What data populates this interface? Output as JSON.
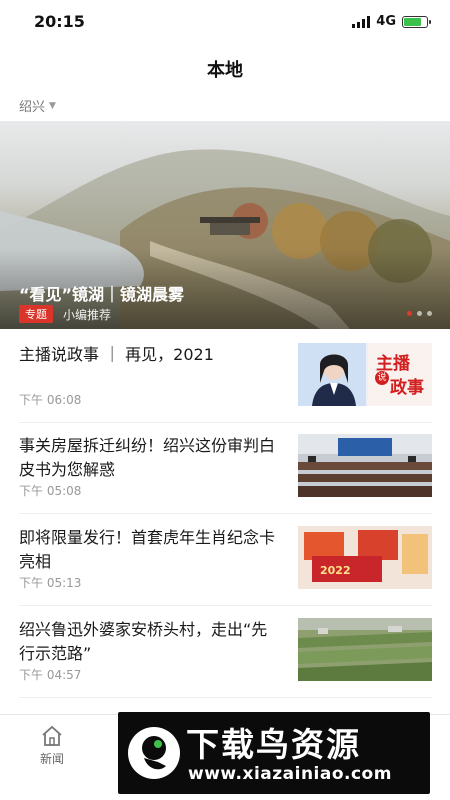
{
  "status_bar": {
    "time": "20:15",
    "network": "4G",
    "battery_level": 0.75,
    "battery_color": "#3cc14b"
  },
  "header": {
    "title": "本地",
    "city": "绍兴"
  },
  "banner": {
    "title": "“看见”镜湖｜镜湖晨雾",
    "tag": "专题",
    "meta": "小编推荐",
    "dot_count": 3,
    "active_dot": 0,
    "accent_color": "#d9352b"
  },
  "news": [
    {
      "title": "主播说政事 ｜ 再见，2021",
      "time": "下午 06:08",
      "thumb": "anchor-thumbnail"
    },
    {
      "title": "事关房屋拆迁纠纷！绍兴这份审判白皮书为您解惑",
      "time": "下午 05:08",
      "thumb": "courtroom-thumbnail"
    },
    {
      "title": "即将限量发行！首套虎年生肖纪念卡亮相",
      "time": "下午 05:13",
      "thumb": "card-thumbnail"
    },
    {
      "title": "绍兴鲁迅外婆家安桥头村，走出“先行示范路”",
      "time": "下午 04:57",
      "thumb": "village-thumbnail"
    }
  ],
  "thumb_text": {
    "anchor_line1": "主播",
    "anchor_mid": "说",
    "anchor_line2": "政事"
  },
  "tabbar": {
    "news_label": "新闻",
    "news_icon": "home-icon"
  },
  "watermark": {
    "title": "下载鸟资源",
    "url": "www.xiazainiao.com"
  }
}
